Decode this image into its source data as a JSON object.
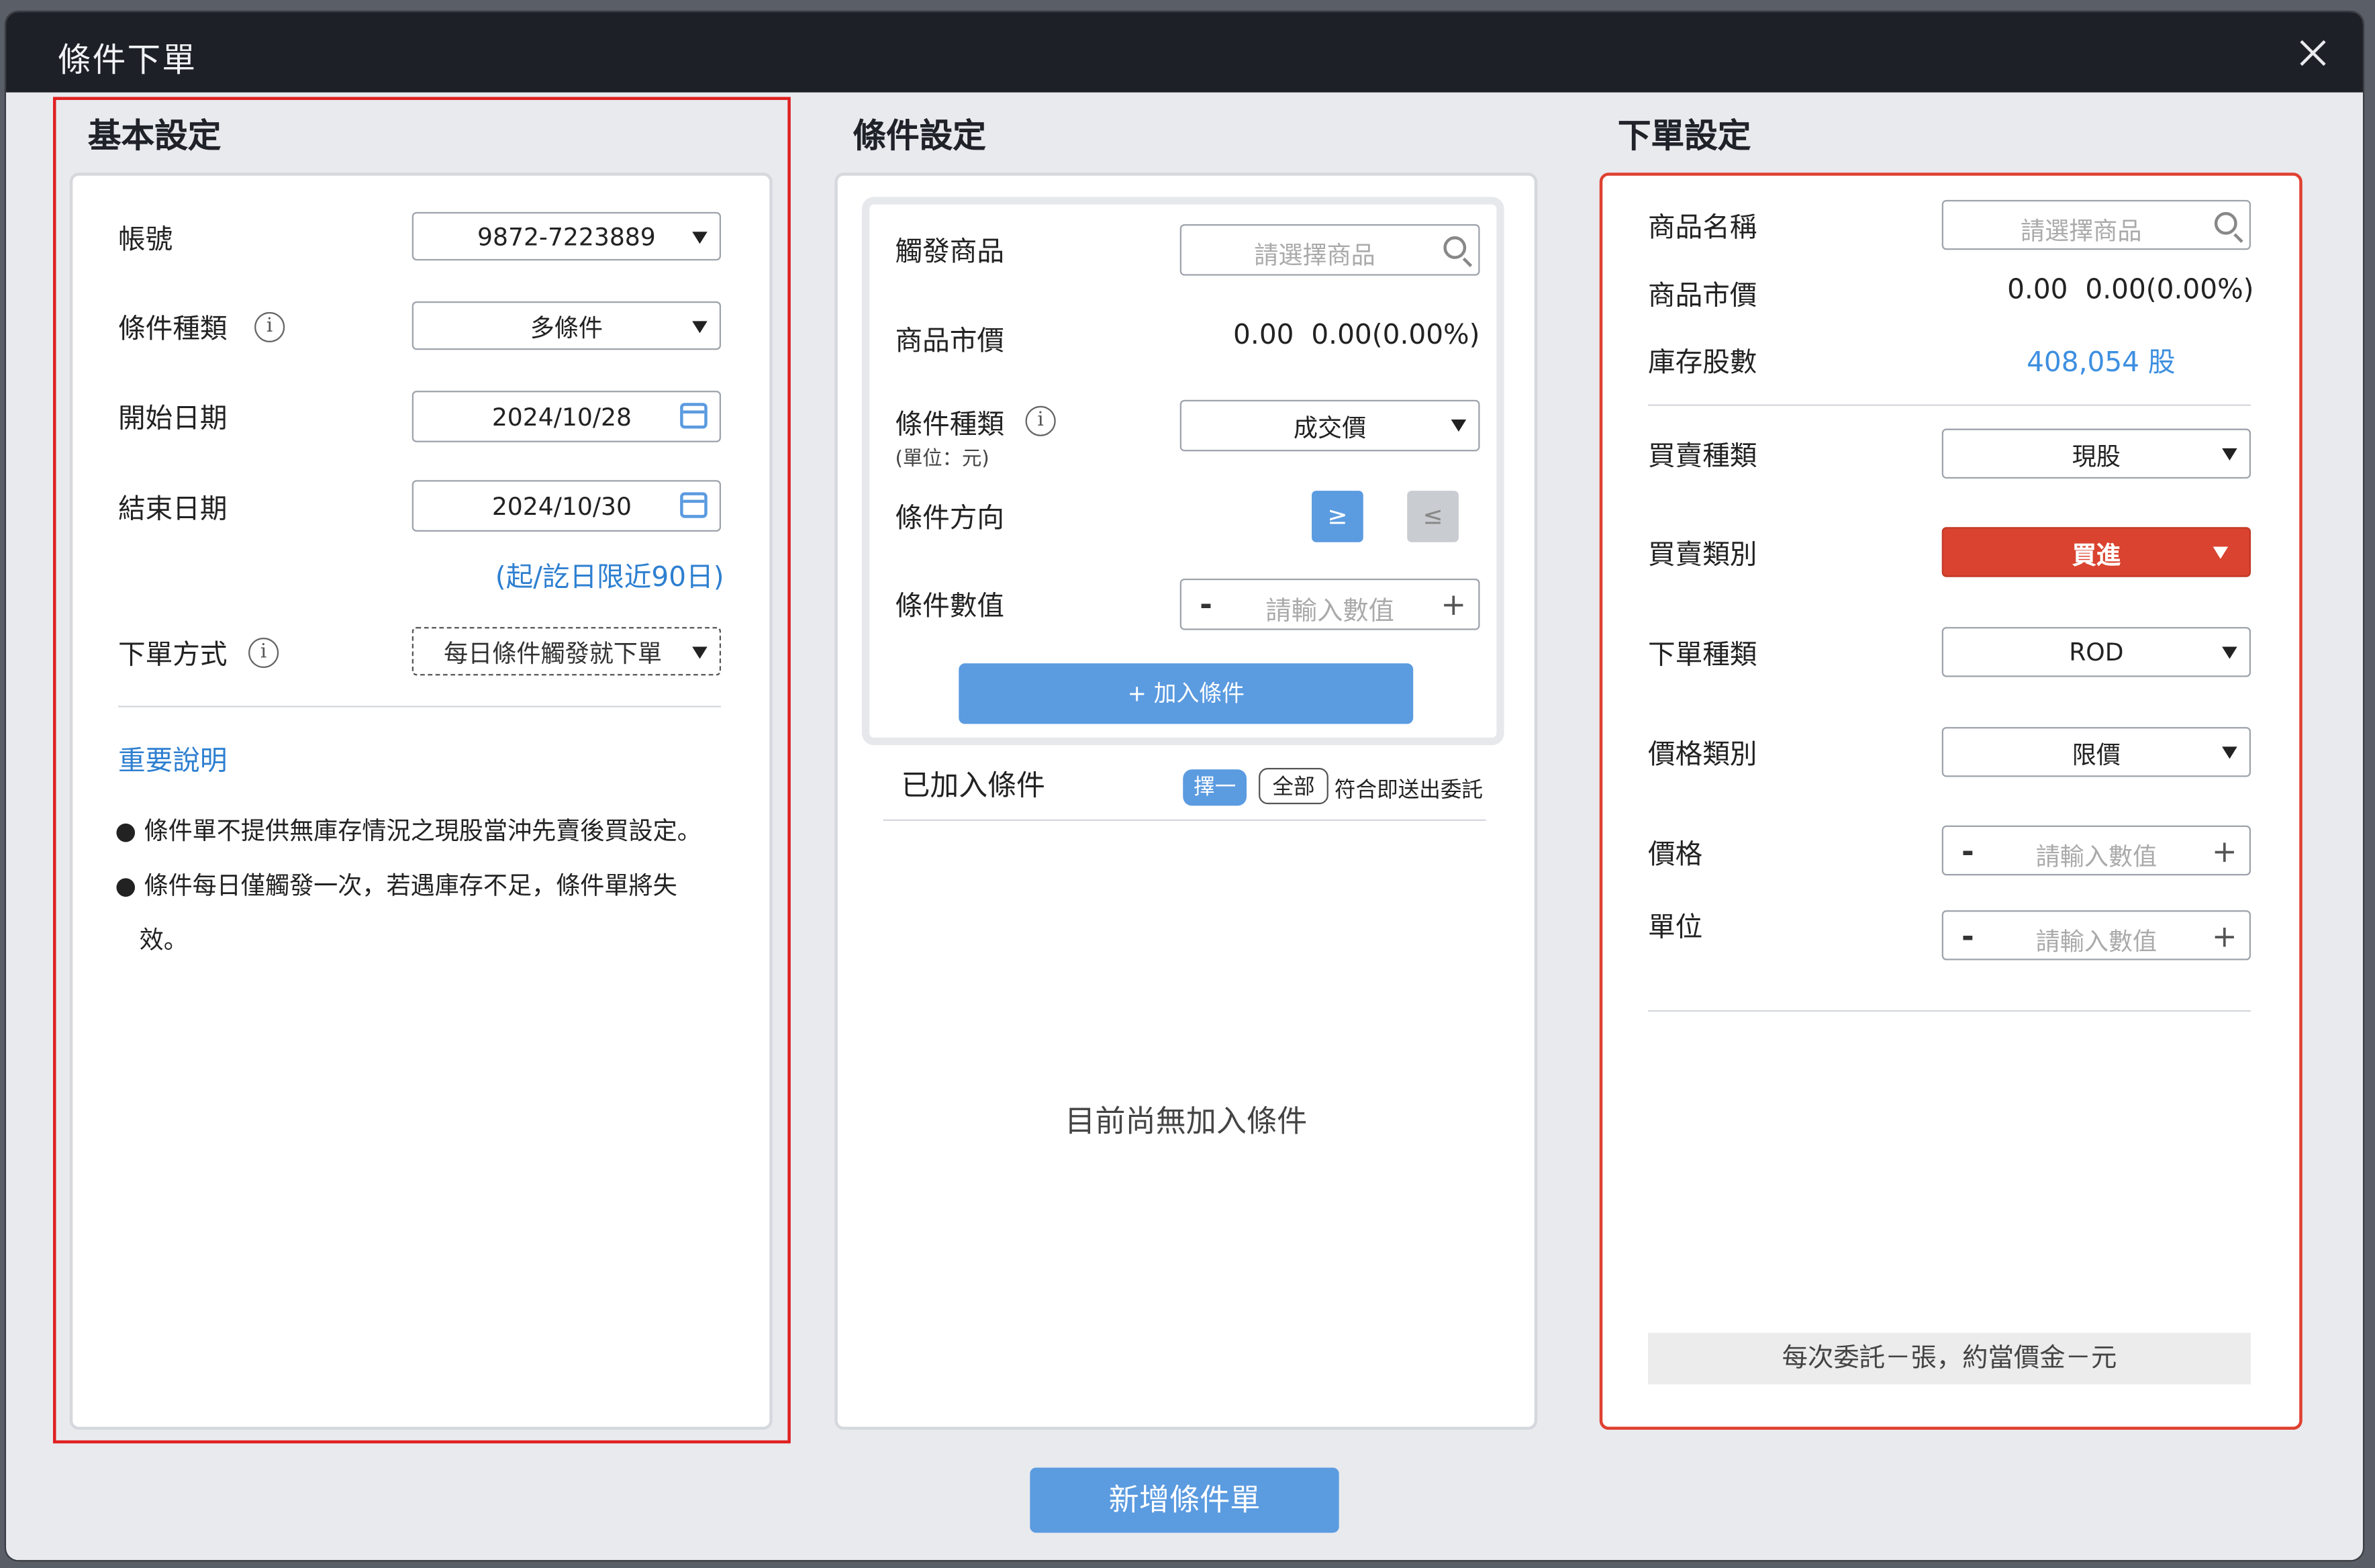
{
  "dialog": {
    "title": "條件下單"
  },
  "basic": {
    "section_title": "基本設定",
    "account_label": "帳號",
    "account_value": "9872-7223889",
    "cond_type_label": "條件種類",
    "cond_type_value": "多條件",
    "start_label": "開始日期",
    "start_value": "2024/10/28",
    "end_label": "結束日期",
    "end_value": "2024/10/30",
    "range_note": "(起/訖日限近90日)",
    "order_mode_label": "下單方式",
    "order_mode_value": "每日條件觸發就下單",
    "important_title": "重要說明",
    "notes": [
      "條件單不提供無庫存情況之現股當沖先賣後買設定。",
      "條件每日僅觸發一次，若遇庫存不足，條件單將失",
      "效。"
    ]
  },
  "condition": {
    "section_title": "條件設定",
    "trigger_label": "觸發商品",
    "trigger_placeholder": "請選擇商品",
    "market_label": "商品市價",
    "market_price": "0.00",
    "market_change": "0.00(0.00%)",
    "cond_type_label": "條件種類",
    "unit_note": "(單位：元)",
    "cond_type_value": "成交價",
    "direction_label": "條件方向",
    "gte": "≥",
    "lte": "≤",
    "value_label": "條件數值",
    "value_placeholder": "請輸入數值",
    "minus": "-",
    "plus": "+",
    "add_button": "+ 加入條件",
    "added_title": "已加入條件",
    "chip_one": "擇一",
    "chip_all": "全部",
    "chip_note": "符合即送出委託",
    "empty_text": "目前尚無加入條件"
  },
  "order": {
    "section_title": "下單設定",
    "product_label": "商品名稱",
    "product_placeholder": "請選擇商品",
    "market_label": "商品市價",
    "market_price": "0.00",
    "market_change": "0.00(0.00%)",
    "stock_label": "庫存股數",
    "stock_value": "408,054 股",
    "trade_type_label": "買賣種類",
    "trade_type_value": "現股",
    "side_label": "買賣類別",
    "side_value": "買進",
    "order_type_label": "下單種類",
    "order_type_value": "ROD",
    "price_type_label": "價格類別",
    "price_type_value": "限價",
    "price_label": "價格",
    "price_placeholder": "請輸入數值",
    "unit_label": "單位",
    "unit_placeholder": "請輸入數值",
    "minus": "-",
    "plus": "+",
    "summary": "每次委託－張，約當價金－元"
  },
  "submit_button": "新增條件單",
  "colors": {
    "accent": "#5b9be0",
    "buy_red": "#d9432f",
    "highlight": "#e02020"
  }
}
